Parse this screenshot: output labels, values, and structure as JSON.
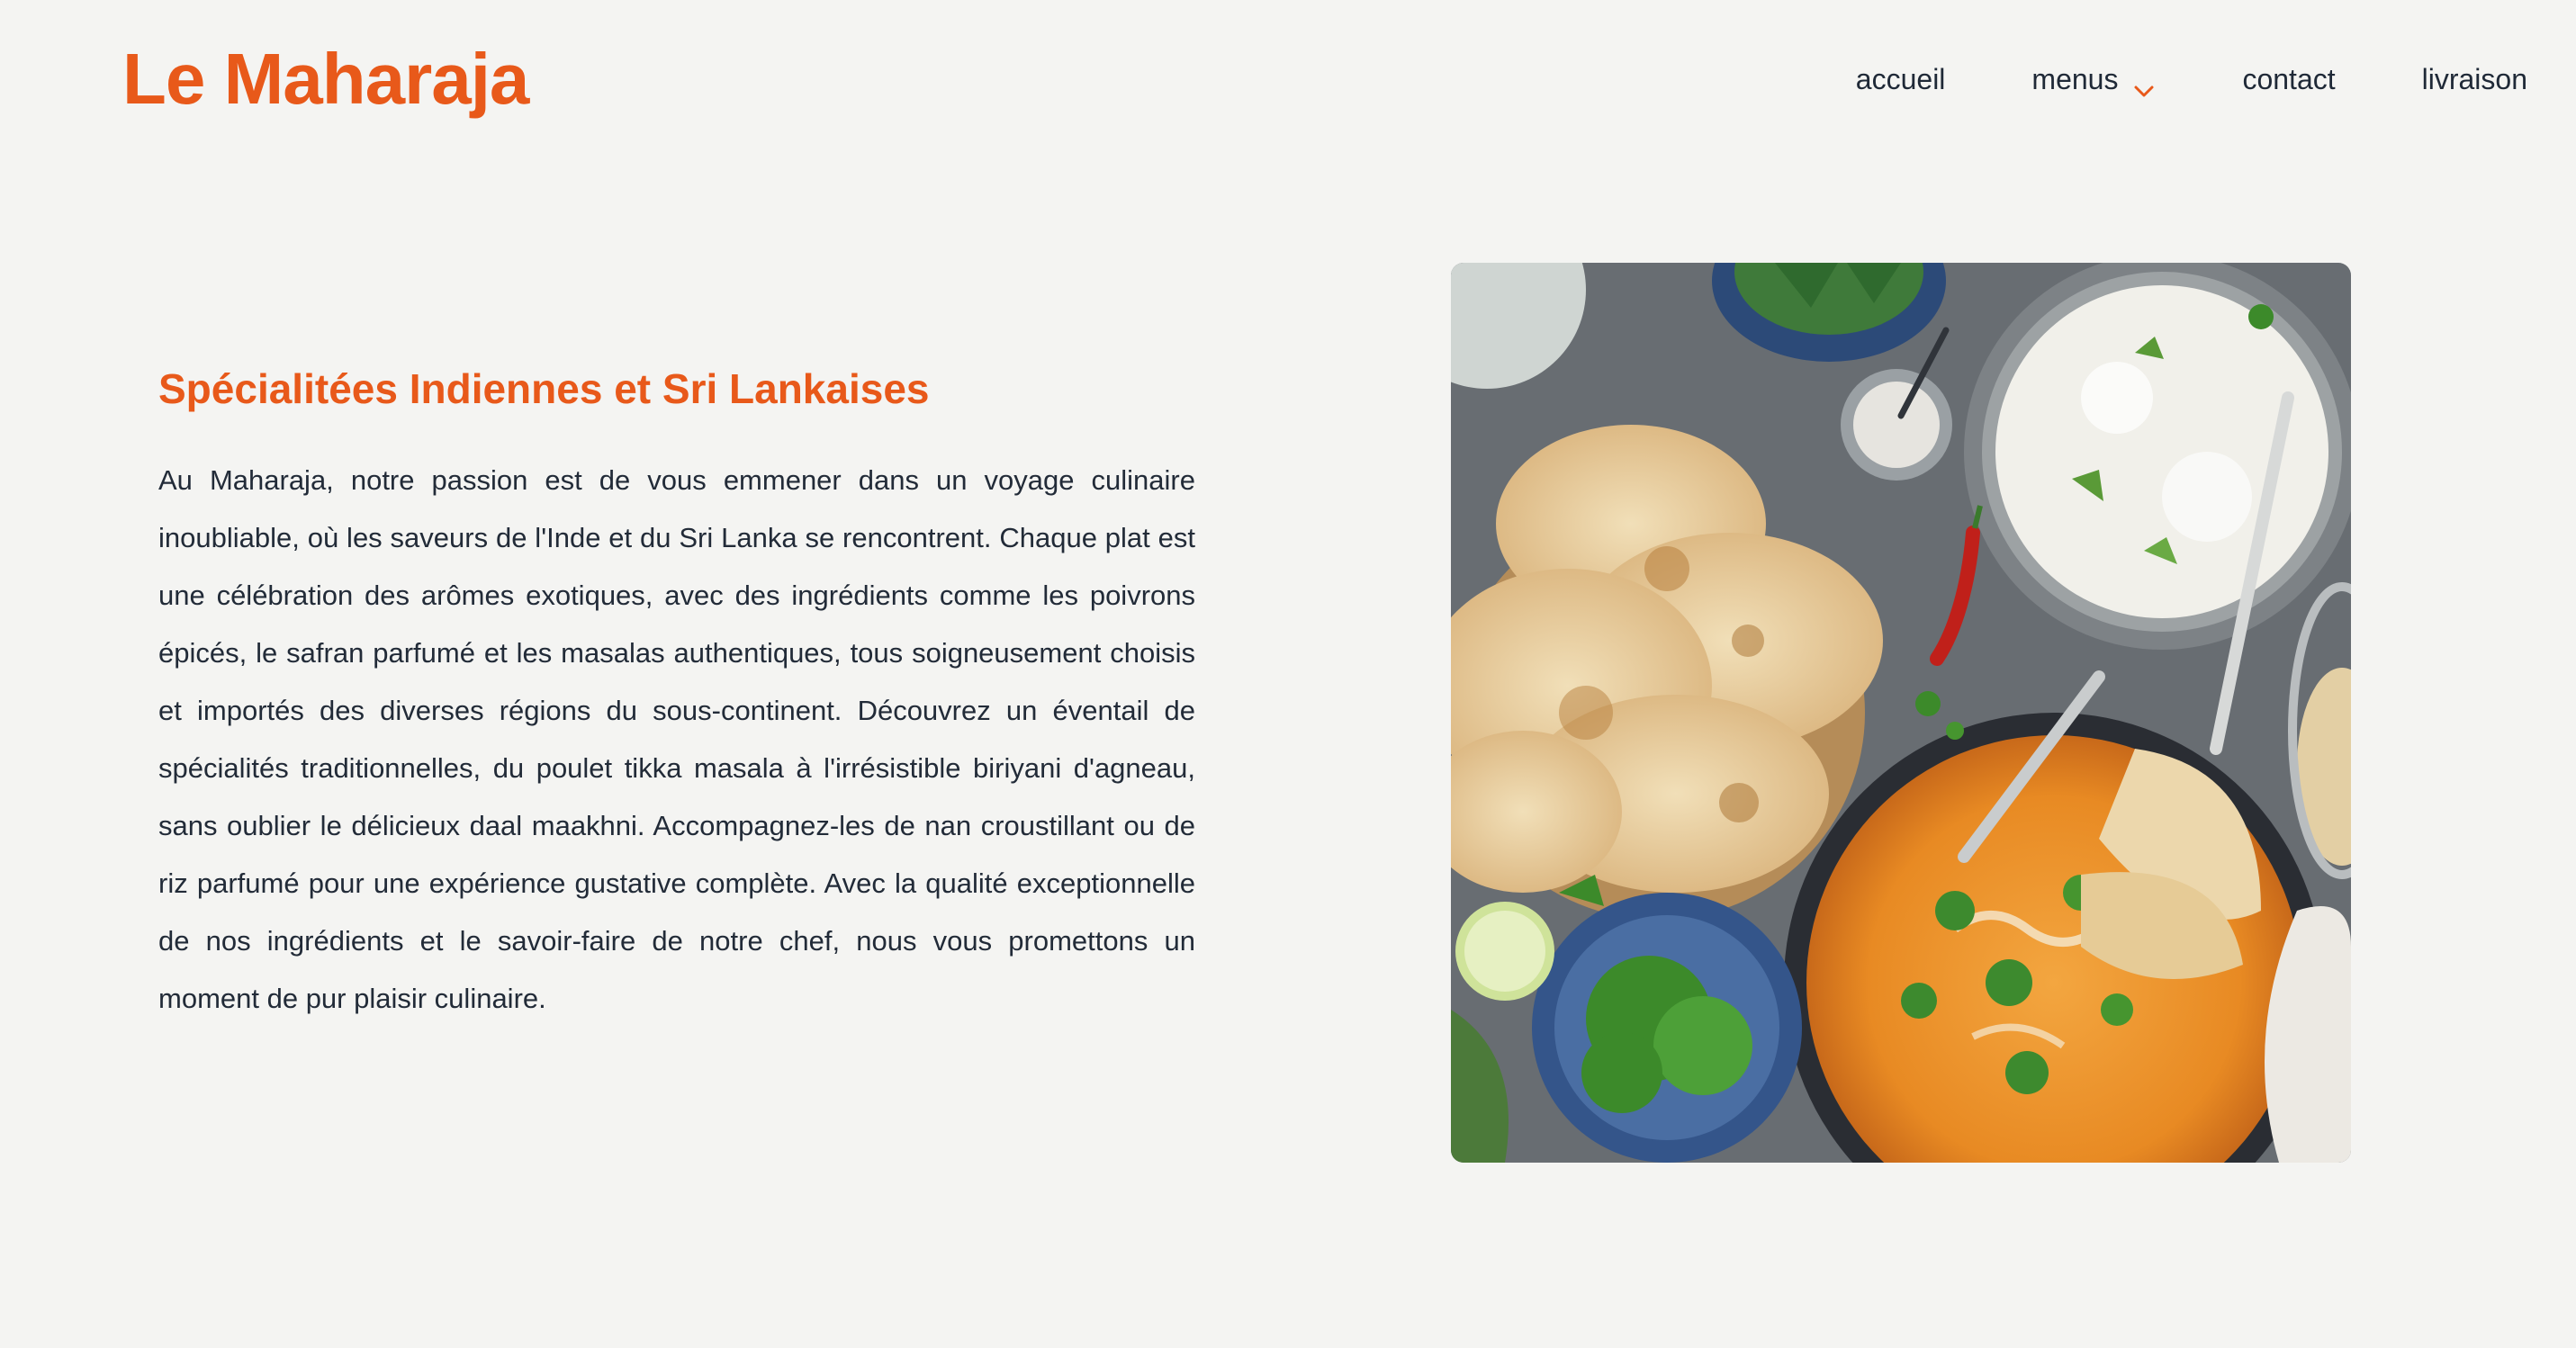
{
  "header": {
    "logo": "Le Maharaja",
    "nav": {
      "home": "accueil",
      "menus": "menus",
      "contact": "contact",
      "delivery": "livraison"
    }
  },
  "hero": {
    "title": "Spécialitées Indiennes et Sri Lankaises",
    "body": "Au Maharaja, notre passion est de vous emmener dans un voyage culinaire inoubliable, où les saveurs de l'Inde et du Sri Lanka se rencontrent. Chaque plat est une célébration des arômes exotiques, avec des ingrédients comme les poivrons épicés, le safran parfumé et les masalas authentiques, tous soigneusement choisis et importés des diverses régions du sous-continent. Découvrez un éventail de spécialités traditionnelles, du poulet tikka masala à l'irrésistible biriyani d'agneau, sans oublier le délicieux daal maakhni. Accompagnez-les de nan croustillant ou de riz parfumé pour une expérience gustative complète. Avec la qualité exceptionnelle de nos ingrédients et le savoir-faire de notre chef, nous vous promettons un moment de pur plaisir culinaire."
  },
  "colors": {
    "accent": "#e8591a",
    "background": "#f4f4f2",
    "text": "#222b38"
  },
  "icons": {
    "menus_dropdown": "chevron-down-icon"
  }
}
